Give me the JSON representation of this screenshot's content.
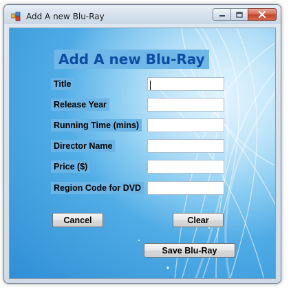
{
  "window": {
    "title": "Add A new Blu-Ray",
    "icon": "app-form-icon",
    "caption_buttons": [
      "minimize-icon",
      "maximize-icon",
      "close-icon"
    ]
  },
  "form": {
    "heading": "Add A new Blu-Ray",
    "fields": [
      {
        "label": "Title",
        "value": ""
      },
      {
        "label": "Release Year",
        "value": ""
      },
      {
        "label": "Running Time (mins)",
        "value": ""
      },
      {
        "label": "Director Name",
        "value": ""
      },
      {
        "label": "Price ($)",
        "value": ""
      },
      {
        "label": "Region Code for DVD",
        "value": ""
      }
    ],
    "buttons": {
      "cancel": "Cancel",
      "clear": "Clear",
      "save": "Save Blu-Ray"
    }
  },
  "colors": {
    "heading_text": "#0c4da2",
    "background_blue": "#2f8fd6",
    "label_background": "#6bb5e6"
  }
}
